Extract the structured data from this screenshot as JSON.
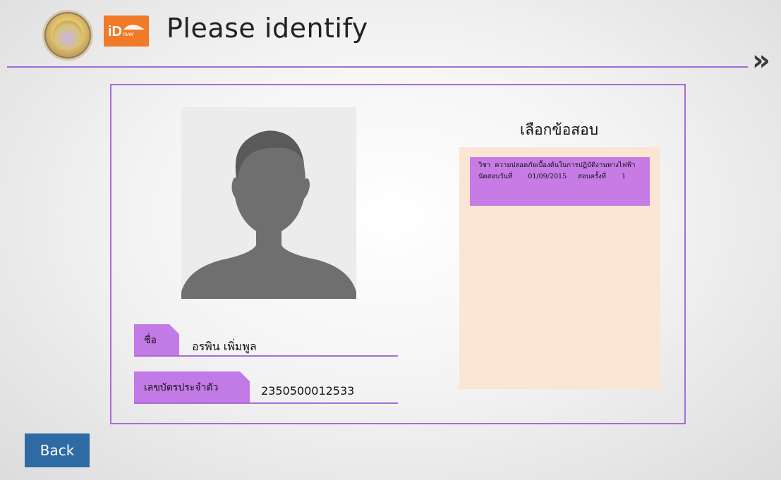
{
  "header": {
    "title": "Please identify",
    "logo_text": "iDriver",
    "next_glyph": "»"
  },
  "profile": {
    "name_label": "ชื่อ",
    "name_value": "อรพิน  เพิ่มพูล",
    "id_label": "เลขบัตรประจำตัว",
    "id_value": "2350500012533"
  },
  "exam": {
    "heading": "เลือกข้อสอบ",
    "items": [
      {
        "subject_label": "วิชา",
        "subject": "ความปลอดภัยเบื้องต้นในการปฏิบัติงานทางไฟฟ้า",
        "date_label": "นัดสอบวันที่",
        "date": "01/09/2015",
        "attempt_label": "สอบครั้งที่",
        "attempt": "1"
      }
    ]
  },
  "footer": {
    "back_label": "Back"
  },
  "colors": {
    "accent_purple": "#a86bd8",
    "tab_purple": "#c27ae6",
    "panel_peach": "#fbe5d3",
    "back_blue": "#2e6ba4",
    "logo_orange": "#f07a27"
  }
}
